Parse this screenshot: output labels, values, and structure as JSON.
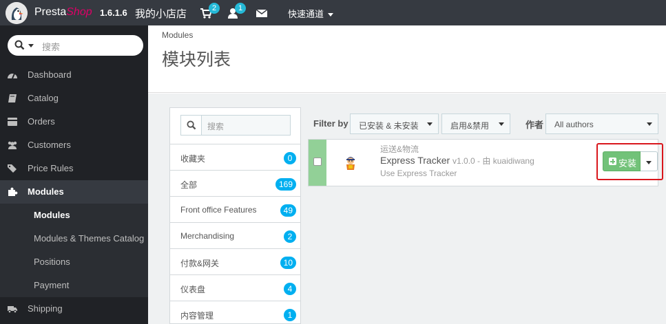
{
  "topbar": {
    "brand_main": "Presta",
    "brand_accent": "Shop",
    "version": "1.6.1.6",
    "store_name": "我的小店店",
    "cart_badge": "2",
    "customer_badge": "1",
    "quick_access": "快速通道"
  },
  "sidebar": {
    "search_placeholder": "搜索",
    "items": [
      {
        "label": "Dashboard",
        "icon": "dashboard-icon"
      },
      {
        "label": "Catalog",
        "icon": "book-icon"
      },
      {
        "label": "Orders",
        "icon": "credit-card-icon"
      },
      {
        "label": "Customers",
        "icon": "users-icon"
      },
      {
        "label": "Price Rules",
        "icon": "tags-icon"
      },
      {
        "label": "Modules",
        "icon": "puzzle-icon"
      },
      {
        "label": "Shipping",
        "icon": "truck-icon"
      }
    ],
    "sub_items": [
      {
        "label": "Modules"
      },
      {
        "label": "Modules & Themes Catalog"
      },
      {
        "label": "Positions"
      },
      {
        "label": "Payment"
      }
    ]
  },
  "header": {
    "breadcrumb": "Modules",
    "title": "模块列表"
  },
  "categories": {
    "search_placeholder": "搜索",
    "items": [
      {
        "label": "收藏夹",
        "count": "0"
      },
      {
        "label": "全部",
        "count": "169"
      },
      {
        "label": "Front office Features",
        "count": "49"
      },
      {
        "label": "Merchandising",
        "count": "2"
      },
      {
        "label": "付款&网关",
        "count": "10"
      },
      {
        "label": "仪表盘",
        "count": "4"
      },
      {
        "label": "内容管理",
        "count": "1"
      }
    ]
  },
  "filters": {
    "label": "Filter by",
    "install_status": "已安装 & 未安装",
    "enabled_status": "启用&禁用",
    "author_label": "作者",
    "author_value": "All authors"
  },
  "module": {
    "category": "运送&物流",
    "name": "Express Tracker",
    "version_author": "v1.0.0 - 由 kuaidiwang",
    "description": "Use Express Tracker",
    "install_label": "安装"
  },
  "colors": {
    "topbar": "#363a41",
    "sidebar": "#202226",
    "brand_accent": "#df0067",
    "badge": "#00aff0",
    "install_green": "#72c279",
    "highlight_red": "#d9161c"
  }
}
